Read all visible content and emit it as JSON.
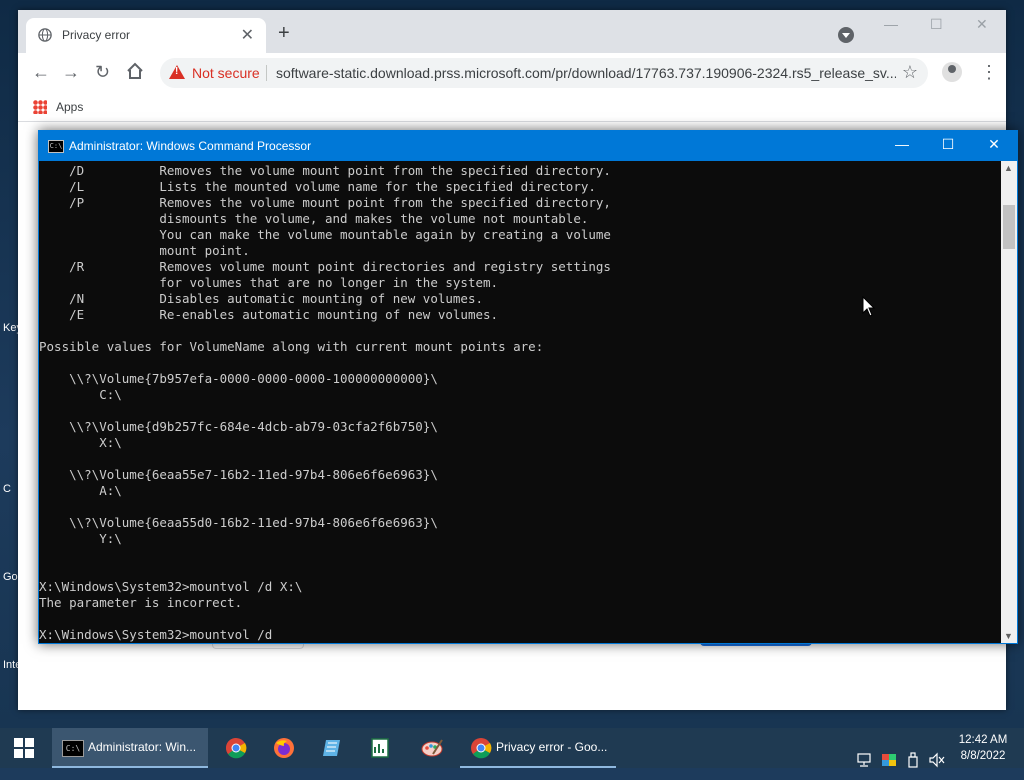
{
  "desktop": {
    "edge_labels": [
      "Key",
      "C",
      "Go",
      "Inte"
    ]
  },
  "browser": {
    "tab": {
      "title": "Privacy error",
      "favicon": "globe-icon",
      "close_icon": "close-icon"
    },
    "new_tab_icon": "plus-icon",
    "window_controls": {
      "minimize": "minimize-icon",
      "maximize": "maximize-icon",
      "close": "close-icon"
    },
    "toolbar": {
      "back_icon": "arrow-left-icon",
      "forward_icon": "arrow-right-icon",
      "reload_icon": "reload-icon",
      "home_icon": "home-icon"
    },
    "omnibox": {
      "security_label": "Not secure",
      "url": "software-static.download.prss.microsoft.com/pr/download/17763.737.190906-2324.rs5_release_sv..."
    },
    "bookmarks": {
      "apps_label": "Apps"
    },
    "colors": {
      "warning": "#d93025",
      "tabstrip": "#dee1e6",
      "accent": "#1a73e8"
    }
  },
  "cmd": {
    "title": "Administrator: Windows Command Processor",
    "icon": "cmd-icon",
    "controls": {
      "minimize": "—",
      "maximize": "☐",
      "close": "✕"
    },
    "colors": {
      "titlebar": "#0078d7",
      "background": "#0c0c0c",
      "text": "#cccccc"
    },
    "console_lines": [
      "    /D          Removes the volume mount point from the specified directory.",
      "    /L          Lists the mounted volume name for the specified directory.",
      "    /P          Removes the volume mount point from the specified directory,",
      "                dismounts the volume, and makes the volume not mountable.",
      "                You can make the volume mountable again by creating a volume",
      "                mount point.",
      "    /R          Removes volume mount point directories and registry settings",
      "                for volumes that are no longer in the system.",
      "    /N          Disables automatic mounting of new volumes.",
      "    /E          Re-enables automatic mounting of new volumes.",
      "",
      "Possible values for VolumeName along with current mount points are:",
      "",
      "    \\\\?\\Volume{7b957efa-0000-0000-0000-100000000000}\\",
      "        C:\\",
      "",
      "    \\\\?\\Volume{d9b257fc-684e-4dcb-ab79-03cfa2f6b750}\\",
      "        X:\\",
      "",
      "    \\\\?\\Volume{6eaa55e7-16b2-11ed-97b4-806e6f6e6963}\\",
      "        A:\\",
      "",
      "    \\\\?\\Volume{6eaa55d0-16b2-11ed-97b4-806e6f6e6963}\\",
      "        Y:\\",
      "",
      "",
      "X:\\Windows\\System32>mountvol /d X:\\",
      "The parameter is incorrect.",
      "",
      "X:\\Windows\\System32>mountvol /d"
    ]
  },
  "taskbar": {
    "start_icon": "windows-logo-icon",
    "items": [
      {
        "label": "Administrator: Win...",
        "icon": "cmd-icon",
        "active": true
      },
      {
        "label": "",
        "icon": "chrome-icon"
      },
      {
        "label": "",
        "icon": "firefox-icon"
      },
      {
        "label": "",
        "icon": "notepad-icon"
      },
      {
        "label": "",
        "icon": "spreadsheet-icon"
      },
      {
        "label": "",
        "icon": "paint-icon"
      },
      {
        "label": "Privacy error - Goo...",
        "icon": "chrome-icon",
        "active": false
      }
    ],
    "tray_icons": [
      "network-icon",
      "color-icon",
      "usb-icon",
      "volume-muted-icon"
    ],
    "clock": {
      "time": "12:42 AM",
      "date": "8/8/2022"
    }
  }
}
